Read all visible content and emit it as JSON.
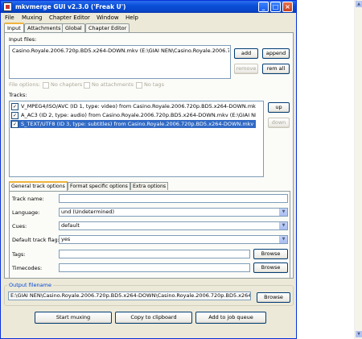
{
  "window": {
    "title": "mkvmerge GUI v2.3.0 ('Freak U')",
    "controls": {
      "minimize": "_",
      "maximize": "□",
      "close": "×"
    }
  },
  "menu": [
    "File",
    "Muxing",
    "Chapter Editor",
    "Window",
    "Help"
  ],
  "tabs": [
    "Input",
    "Attachments",
    "Global",
    "Chapter Editor"
  ],
  "input_files": {
    "label": "Input files:",
    "items": [
      "Casino.Royale.2006.720p.BD5.x264-DOWN.mkv (E:\\GIAI NEN\\Casino.Royale.2006.720p"
    ],
    "buttons": {
      "add": "add",
      "append": "append",
      "remove": "remove",
      "rem_all": "rem all"
    }
  },
  "file_options": {
    "label": "File options:",
    "no_chapters": "No chapters",
    "no_attachments": "No attachments",
    "no_tags": "No tags"
  },
  "tracks": {
    "label": "Tracks:",
    "items": [
      {
        "text": "V_MPEG4/ISO/AVC (ID 1, type: video) from Casino.Royale.2006.720p.BD5.x264-DOWN.mkv (E:\\GIAI NEN\\Ca",
        "checked": "✓",
        "selected": false
      },
      {
        "text": "A_AC3 (ID 2, type: audio) from Casino.Royale.2006.720p.BD5.x264-DOWN.mkv (E:\\GIAI NEN\\Casino.Roya",
        "checked": "✓",
        "selected": false
      },
      {
        "text": "S_TEXT/UTF8 (ID 3, type: subtitles) from Casino.Royale.2006.720p.BD5.x264-DOWN.mkv (E:\\GIAI NEN\\C",
        "checked": "✓",
        "selected": true
      }
    ],
    "buttons": {
      "up": "up",
      "down": "down"
    }
  },
  "track_tabs": [
    "General track options",
    "Format specific options",
    "Extra options"
  ],
  "track_options": {
    "track_name": {
      "label": "Track name:",
      "value": ""
    },
    "language": {
      "label": "Language:",
      "value": "und (Undetermined)"
    },
    "cues": {
      "label": "Cues:",
      "value": "default"
    },
    "default_flag": {
      "label": "Default track flag:",
      "value": "yes"
    },
    "tags": {
      "label": "Tags:",
      "value": "",
      "browse": "Browse"
    },
    "timecodes": {
      "label": "Timecodes:",
      "value": "",
      "browse": "Browse"
    }
  },
  "output": {
    "label": "Output filename",
    "value": "E:\\GIAI NEN\\Casino.Royale.2006.720p.BD5.x264-DOWN\\Casino.Royale.2006.720p.BD5.x264-DOWN.mkv",
    "browse": "Browse"
  },
  "actions": {
    "start": "Start muxing",
    "copy": "Copy to clipboard",
    "queue": "Add to job queue"
  },
  "icons": {
    "app": "mkvmerge-icon",
    "dropdown": "▼",
    "scroll_up": "▲",
    "scroll_down": "▼"
  },
  "colors": {
    "titlebar": "#0a4fd8",
    "selection": "#316ac5",
    "tab_highlight": "#f0b43c"
  }
}
